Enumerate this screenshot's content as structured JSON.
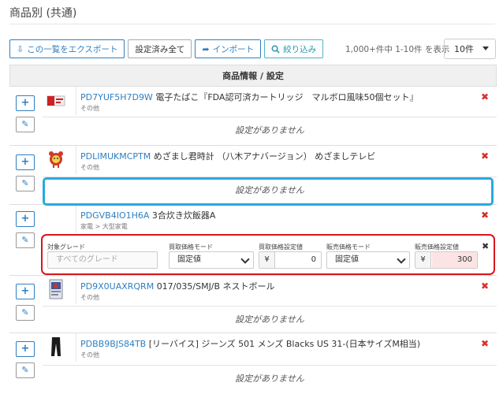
{
  "page": {
    "title": "商品別 (共通)"
  },
  "toolbar": {
    "export_label": "この一覧をエクスポート",
    "settings_all_label": "設定済み全て",
    "import_label": "インポート",
    "filter_label": "絞り込み"
  },
  "pagination": {
    "count_text": "1,000+件中 1-10件 を表示",
    "per_page": "10件"
  },
  "table": {
    "header": "商品情報 / 設定",
    "no_setting_text": "設定がありません"
  },
  "products": [
    {
      "code": "PD7YUF5H7D9W",
      "name": "電子たばこ『FDA認可済カートリッジ　マルボロ風味50個セット』",
      "category": "その他",
      "thumb_icon": "cigarette-box-icon"
    },
    {
      "code": "PDLIMUKMCPTM",
      "name": "めざまし君時計 （八木アナバージョン） めざましテレビ",
      "category": "その他",
      "thumb_icon": "alarm-clock-icon"
    },
    {
      "code": "PDGVB4IO1H6A",
      "name": "3合炊き炊飯器A",
      "category": "家電 > 大型家電",
      "thumb_icon": ""
    },
    {
      "code": "PD9X0UAXRQRM",
      "name": "017/035/SMJ/B ネストボール",
      "category": "その他",
      "thumb_icon": "trading-card-icon"
    },
    {
      "code": "PDBB9BJS84TB",
      "name": "[リーバイス] ジーンズ 501 メンズ Blacks US 31-(日本サイズM相当)",
      "category": "その他",
      "thumb_icon": "jeans-icon"
    }
  ],
  "settings_row": {
    "grade_label": "対象グレード",
    "grade_placeholder": "すべてのグレード",
    "buy_mode_label": "買取価格モード",
    "buy_mode_value": "固定値",
    "buy_price_label": "買取価格設定値",
    "buy_price_value": "0",
    "sell_mode_label": "販売価格モード",
    "sell_mode_value": "固定値",
    "sell_price_label": "販売価格設定値",
    "sell_price_value": "300",
    "currency": "¥"
  },
  "colors": {
    "primary": "#2f7fc1",
    "delete": "#d9302c",
    "highlight_blue": "#29a9e0",
    "highlight_red": "#d8161c"
  }
}
